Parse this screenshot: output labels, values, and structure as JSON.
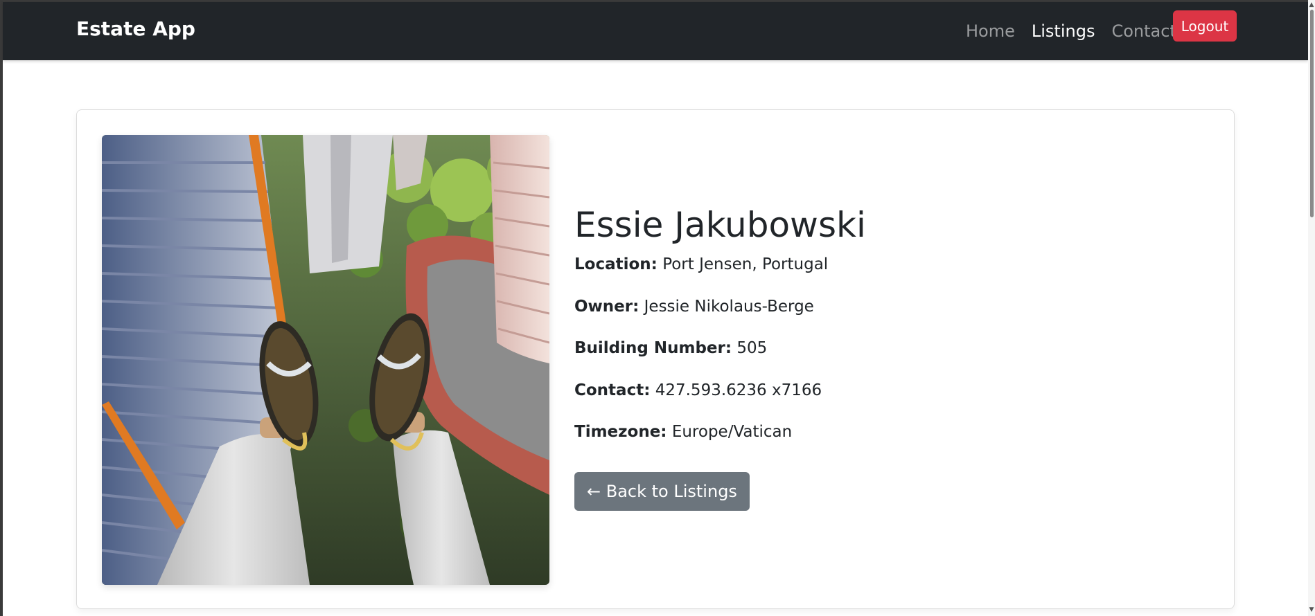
{
  "navbar": {
    "brand": "Estate App",
    "links": [
      {
        "label": "Home",
        "active": false
      },
      {
        "label": "Listings",
        "active": true
      },
      {
        "label": "Contact",
        "active": false
      }
    ],
    "logout_label": "Logout"
  },
  "listing": {
    "name": "Essie Jakubowski",
    "image_description": "rooftop-view-feet-over-city",
    "fields": [
      {
        "label": "Location:",
        "value": "Port Jensen, Portugal"
      },
      {
        "label": "Owner:",
        "value": "Jessie Nikolaus-Berge"
      },
      {
        "label": "Building Number:",
        "value": "505"
      },
      {
        "label": "Contact:",
        "value": "427.593.6236 x7166"
      },
      {
        "label": "Timezone:",
        "value": "Europe/Vatican"
      }
    ],
    "back_label": "← Back to Listings"
  },
  "colors": {
    "navbar_bg": "#212529",
    "logout_bg": "#dc3545",
    "back_btn_bg": "#6c757d"
  }
}
